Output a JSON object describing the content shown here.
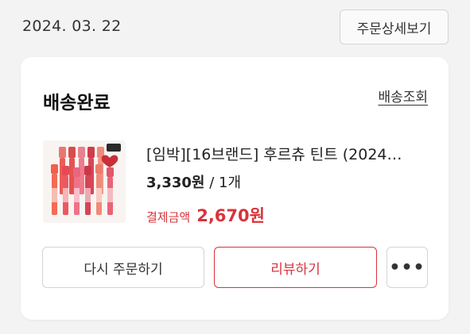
{
  "order": {
    "date": "2024. 03. 22",
    "detail_button": "주문상세보기"
  },
  "card": {
    "status": "배송완료",
    "track_link": "배송조회",
    "product": {
      "name": "[임박][16브랜드] 후르츄 틴트 (2024…",
      "image_icon": "lip-tint-product-image",
      "unit_price": "3,330원",
      "separator": " / ",
      "quantity": "1개",
      "pay_label": "결제금액",
      "pay_amount": "2,670원"
    },
    "buttons": {
      "reorder": "다시 주문하기",
      "review": "리뷰하기",
      "more": "•••"
    }
  },
  "colors": {
    "accent": "#d9333b",
    "background": "#f3f3f3",
    "card": "#ffffff",
    "border": "#d4d4d4"
  }
}
